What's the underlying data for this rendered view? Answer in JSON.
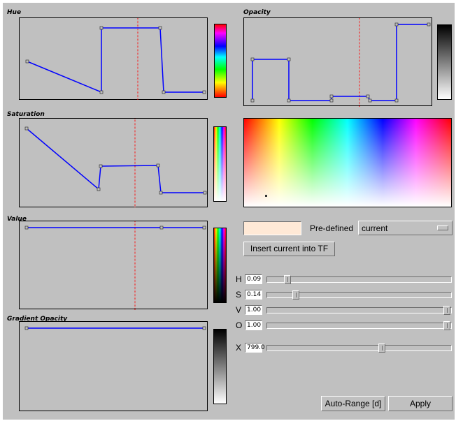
{
  "panels": {
    "hue": {
      "title": "Hue"
    },
    "saturation": {
      "title": "Saturation"
    },
    "value": {
      "title": "Value"
    },
    "gradient_opacity": {
      "title": "Gradient Opacity"
    },
    "opacity": {
      "title": "Opacity"
    }
  },
  "controls": {
    "predefined_label": "Pre-defined",
    "predefined_value": "current",
    "insert_button": "Insert current into TF",
    "auto_range_button": "Auto-Range [d]",
    "apply_button": "Apply",
    "swatch_color": "#ffe9d6"
  },
  "sliders": {
    "h": {
      "label": "H",
      "value": "0.09",
      "fraction": 0.09
    },
    "s": {
      "label": "S",
      "value": "0.14",
      "fraction": 0.14
    },
    "v": {
      "label": "V",
      "value": "1.00",
      "fraction": 1.0
    },
    "o": {
      "label": "O",
      "value": "1.00",
      "fraction": 1.0
    },
    "x": {
      "label": "X",
      "value": "799.0",
      "fraction": 0.63
    }
  },
  "colors": {
    "curve": "#0000ff",
    "marker": "#ff0000",
    "point": "#c0c0c0"
  }
}
